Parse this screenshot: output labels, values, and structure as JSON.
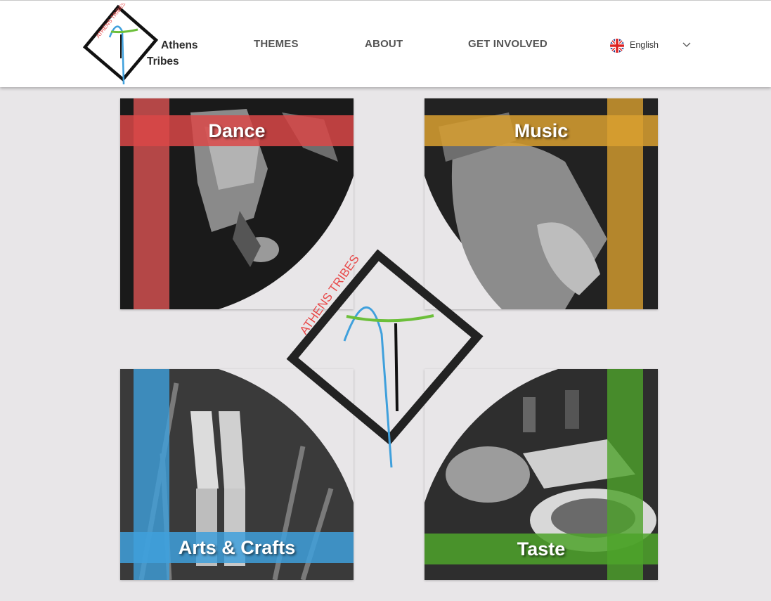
{
  "header": {
    "brand_line1": "Athens",
    "brand_line2": "Tribes",
    "logo_arc_text": "ATHENS TRIBES",
    "nav": [
      {
        "label": "THEMES"
      },
      {
        "label": "ABOUT"
      },
      {
        "label": "GET INVOLVED"
      }
    ],
    "language": {
      "label": "English",
      "flag": "uk-flag-icon"
    }
  },
  "center_logo": {
    "arc_text": "ATHENS TRIBES"
  },
  "cards": [
    {
      "title": "Dance",
      "accent": "#e05555"
    },
    {
      "title": "Music",
      "accent": "#d9a030"
    },
    {
      "title": "Arts & Crafts",
      "accent": "#3fa0dc"
    },
    {
      "title": "Taste",
      "accent": "#4ea32a"
    }
  ],
  "colors": {
    "background": "#e8e6e8",
    "header": "#ffffff",
    "nav_text": "#555555",
    "logo_blue": "#3fa0dc",
    "logo_green": "#6cbf3a",
    "logo_red": "#e84848"
  }
}
